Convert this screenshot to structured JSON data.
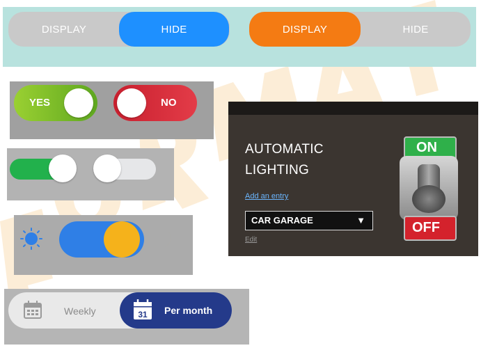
{
  "display_hide_1": {
    "display": "DISPLAY",
    "hide": "HIDE",
    "selected": "HIDE"
  },
  "display_hide_2": {
    "display": "DISPLAY",
    "hide": "HIDE",
    "selected": "DISPLAY"
  },
  "yes_toggle": {
    "label": "YES",
    "on": true,
    "color": "#7fbf2a"
  },
  "no_toggle": {
    "label": "NO",
    "on": false,
    "color": "#d42a36"
  },
  "green_toggle": {
    "on": true,
    "color": "#22b14c"
  },
  "gray_toggle": {
    "on": false
  },
  "day_night_toggle": {
    "on": true,
    "track_color": "#2f7fe6",
    "knob_color": "#f5b21b"
  },
  "period_switch": {
    "weekly": "Weekly",
    "per_month": "Per month",
    "calendar_day": "31",
    "selected": "Per month",
    "accent": "#243a8a"
  },
  "lighting": {
    "title_line1": "AUTOMATIC",
    "title_line2": "LIGHTING",
    "add_entry": "Add an entry",
    "location": "CAR GARAGE",
    "edit": "Edit",
    "switch_on": "ON",
    "switch_off": "OFF"
  },
  "watermark": "FORMATI"
}
